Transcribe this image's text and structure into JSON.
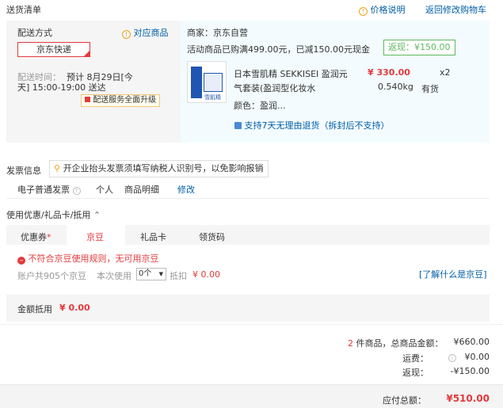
{
  "header": {
    "title": "送货清单",
    "price_note": "价格说明",
    "back_to_cart": "返回修改购物车"
  },
  "shipping": {
    "method_label": "配送方式",
    "method_link": "对应商品",
    "courier": "京东快递",
    "time_label": "配送时间：",
    "time_value_1": "预计 8月29日[今",
    "time_value_2": "天] 15:00-19:00 送达",
    "upgrade": "配送服务全面升级"
  },
  "shop": {
    "seller": "商家：京东自营",
    "promo": "活动商品已购满499.00元，已减150.00元现金",
    "rebate": "返现：¥150.00"
  },
  "product": {
    "name_1": "日本雪肌精 SEKKISEI 盈润元",
    "name_2": "气套装(盈润型化妆水",
    "price": "¥ 330.00",
    "qty": "x2",
    "weight": "0.540kg",
    "stock": "有货",
    "color": "颜色：盈润...",
    "return_policy": "支持7天无理由退货（拆封后不支持）",
    "thumb_text": "雪肌精"
  },
  "invoice": {
    "title": "发票信息",
    "tip": "开企业抬头发票须填写纳税人识别号，以免影响报销",
    "type": "电子普通发票",
    "person": "个人",
    "detail": "商品明细",
    "edit": "修改"
  },
  "discount": {
    "title": "使用优惠/礼品卡/抵用",
    "tabs": [
      "优惠券",
      "京豆",
      "礼品卡",
      "领货码"
    ],
    "coupon_star": "*",
    "error": "不符合京豆使用规则，无可用京豆",
    "account": "账户共905个京豆",
    "use_label": "本次使用",
    "use_value": "0个",
    "deduct_label": "抵扣",
    "deduct_value": "¥ 0.00",
    "learn": "[了解什么是京豆]",
    "total_label": "金额抵用",
    "total_value": "¥ 0.00"
  },
  "summary": {
    "count": "2",
    "count_label": "件商品，总商品金额：",
    "goods_total": "¥660.00",
    "freight_label": "运费：",
    "freight": "¥0.00",
    "rebate_label": "返现：",
    "rebate": "-¥150.00",
    "payable_label": "应付总额：",
    "payable": "¥510.00"
  }
}
